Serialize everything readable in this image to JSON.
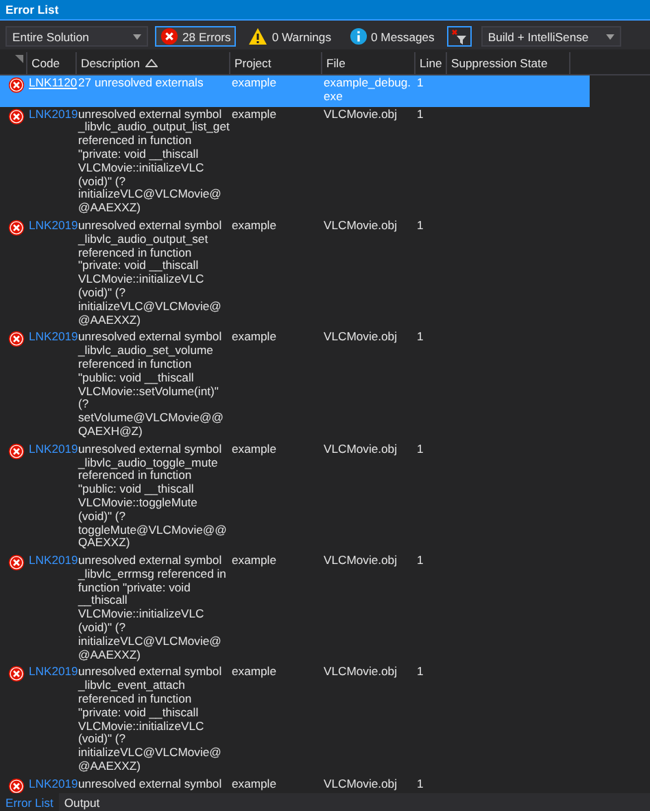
{
  "window": {
    "title": "Error List"
  },
  "toolbar": {
    "scope": "Entire Solution",
    "filters": [
      {
        "kind": "error",
        "label": "28 Errors",
        "selected": true
      },
      {
        "kind": "warning",
        "label": "0 Warnings",
        "selected": false
      },
      {
        "kind": "info",
        "label": "0 Messages",
        "selected": false
      }
    ],
    "source": "Build + IntelliSense"
  },
  "table": {
    "columns": [
      "Code",
      "Description",
      "Project",
      "File",
      "Line",
      "Suppression State"
    ],
    "rows": [
      {
        "selected": true,
        "code": "LNK1120",
        "description": "27 unresolved externals",
        "project": "example",
        "file": "example_debug.exe",
        "line": "1"
      },
      {
        "selected": false,
        "code": "LNK2019",
        "description": "unresolved external symbol _libvlc_audio_output_list_get referenced in function \"private: void __thiscall VLCMovie::initializeVLC (void)\" (?initializeVLC@VLCMovie@@AAEXXZ)",
        "project": "example",
        "file": "VLCMovie.obj",
        "line": "1"
      },
      {
        "selected": false,
        "code": "LNK2019",
        "description": "unresolved external symbol _libvlc_audio_output_set referenced in function \"private: void __thiscall VLCMovie::initializeVLC (void)\" (?initializeVLC@VLCMovie@@AAEXXZ)",
        "project": "example",
        "file": "VLCMovie.obj",
        "line": "1"
      },
      {
        "selected": false,
        "code": "LNK2019",
        "description": "unresolved external symbol _libvlc_audio_set_volume referenced in function \"public: void __thiscall VLCMovie::setVolume(int)\" (?setVolume@VLCMovie@@QAEXH@Z)",
        "project": "example",
        "file": "VLCMovie.obj",
        "line": "1"
      },
      {
        "selected": false,
        "code": "LNK2019",
        "description": "unresolved external symbol _libvlc_audio_toggle_mute referenced in function \"public: void __thiscall VLCMovie::toggleMute (void)\" (?toggleMute@VLCMovie@@QAEXXZ)",
        "project": "example",
        "file": "VLCMovie.obj",
        "line": "1"
      },
      {
        "selected": false,
        "code": "LNK2019",
        "description": "unresolved external symbol _libvlc_errmsg referenced in function \"private: void __thiscall VLCMovie::initializeVLC (void)\" (?initializeVLC@VLCMovie@@AAEXXZ)",
        "project": "example",
        "file": "VLCMovie.obj",
        "line": "1"
      },
      {
        "selected": false,
        "code": "LNK2019",
        "description": "unresolved external symbol _libvlc_event_attach referenced in function \"private: void __thiscall VLCMovie::initializeVLC (void)\" (?initializeVLC@VLCMovie@@AAEXXZ)",
        "project": "example",
        "file": "VLCMovie.obj",
        "line": "1"
      },
      {
        "selected": false,
        "code": "LNK2019",
        "description": "unresolved external symbol",
        "project": "example",
        "file": "VLCMovie.obj",
        "line": "1"
      }
    ]
  },
  "bottom_tabs": [
    {
      "label": "Error List",
      "selected": true
    },
    {
      "label": "Output",
      "selected": false
    }
  ]
}
